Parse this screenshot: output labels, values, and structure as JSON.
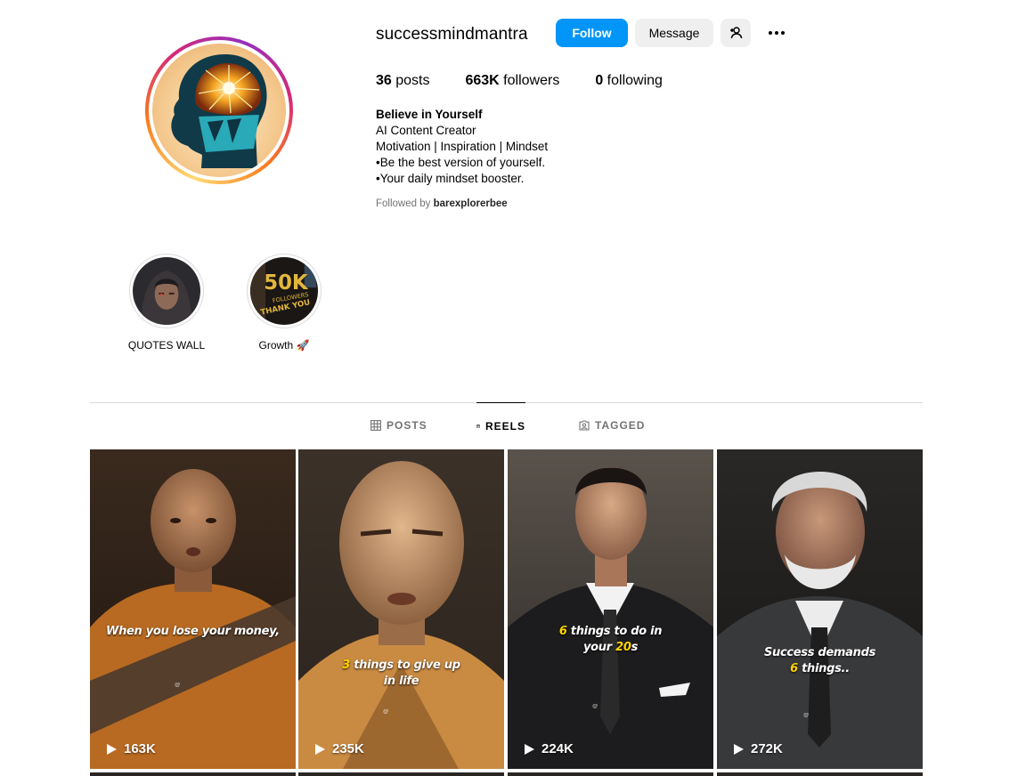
{
  "profile": {
    "username": "successmindmantra",
    "follow_label": "Follow",
    "message_label": "Message",
    "suggest_icon": "add-person-icon",
    "more_icon": "more-options-icon",
    "stats": {
      "posts_count": "36",
      "posts_label": " posts",
      "followers_count": "663K",
      "followers_label": " followers",
      "following_count": "0",
      "following_label": " following"
    },
    "bio": {
      "name": "Believe in Yourself",
      "line1": "AI Content Creator",
      "line2": "Motivation | Inspiration | Mindset",
      "line3": "•Be the best version of yourself.",
      "line4": "•Your daily mindset booster."
    },
    "followed_by_prefix": "Followed by ",
    "followed_by_user": "barexplorerbee",
    "colors": {
      "accent": "#0095f6",
      "muted": "#737373",
      "divider": "#dbdbdb"
    }
  },
  "highlights": [
    {
      "label": "QUOTES WALL"
    },
    {
      "label": "Growth 🚀",
      "image_text_1": "50K",
      "image_text_2": "FOLLOWERS",
      "image_text_3": "THANK YOU"
    }
  ],
  "tabs": [
    {
      "label": "POSTS",
      "icon": "grid-icon",
      "active": false
    },
    {
      "label": "REELS",
      "icon": "reels-icon",
      "active": true
    },
    {
      "label": "TAGGED",
      "icon": "tagged-icon",
      "active": false
    }
  ],
  "reels": [
    {
      "caption_a": "When you lose your money,",
      "views": "163K"
    },
    {
      "caption_hl": "3",
      "caption_a": " things to give up",
      "caption_b": "in life",
      "views": "235K"
    },
    {
      "caption_hl": "6",
      "caption_a": " things to do in",
      "caption_b_pre": "your ",
      "caption_b_hl": "20",
      "caption_b_post": "s",
      "views": "224K"
    },
    {
      "caption_a": "Success demands",
      "caption_b_hl": "6",
      "caption_b_post": " things..",
      "views": "272K"
    }
  ]
}
